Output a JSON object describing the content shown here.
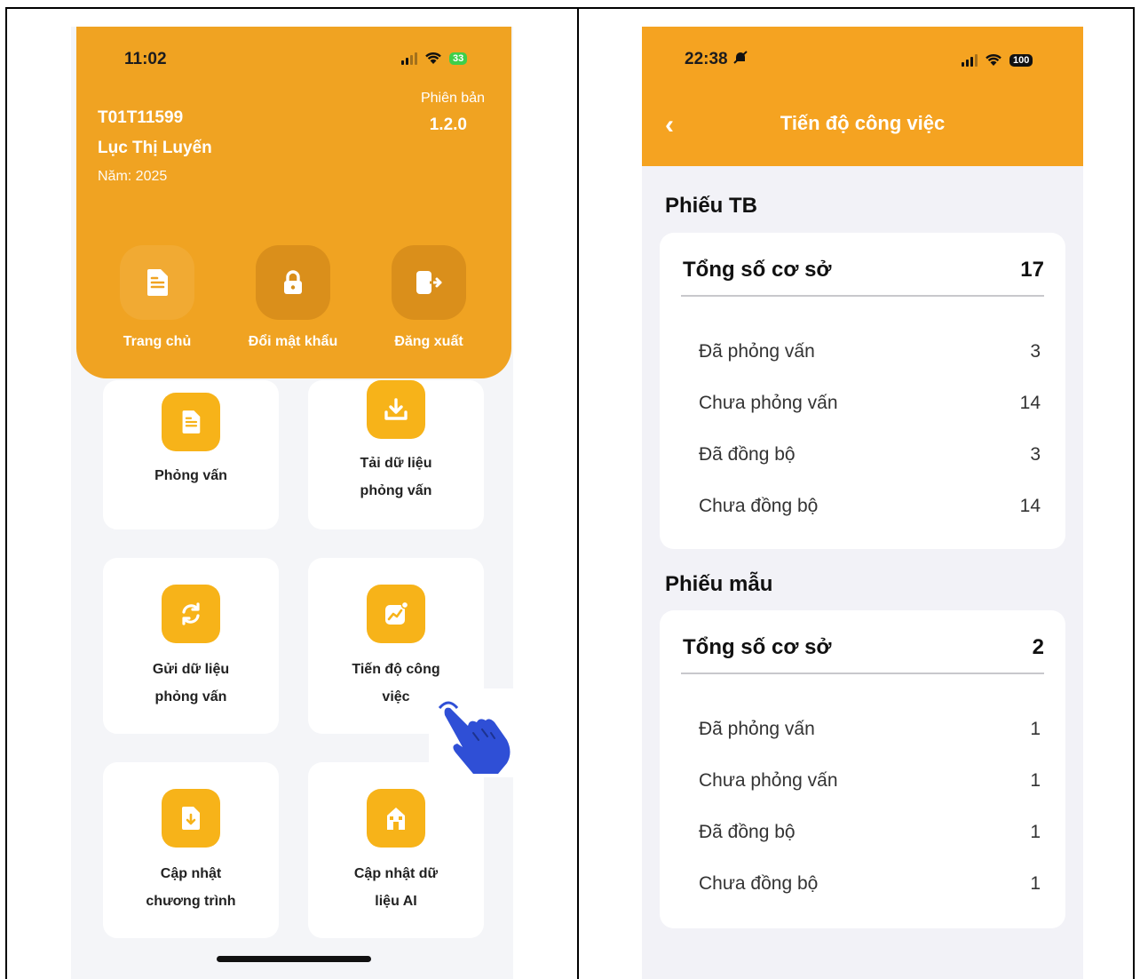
{
  "left": {
    "status": {
      "time": "11:02",
      "battery": "33"
    },
    "user": {
      "code": "T01T11599",
      "name": "Lục Thị Luyến",
      "year": "Năm: 2025"
    },
    "version": {
      "label": "Phiên bản",
      "number": "1.2.0"
    },
    "header_buttons": [
      {
        "label": "Trang chủ",
        "icon": "document-icon"
      },
      {
        "label": "Đổi mật khẩu",
        "icon": "lock-icon"
      },
      {
        "label": "Đăng xuất",
        "icon": "logout-icon"
      }
    ],
    "tiles": [
      {
        "line1": "Phỏng vấn",
        "line2": "",
        "icon": "document-icon"
      },
      {
        "line1": "Tải dữ liệu",
        "line2": "phỏng vấn",
        "icon": "download-icon"
      },
      {
        "line1": "Gửi dữ liệu",
        "line2": "phỏng vấn",
        "icon": "sync-icon"
      },
      {
        "line1": "Tiến độ công",
        "line2": "việc",
        "icon": "chart-icon"
      },
      {
        "line1": "Cập nhật",
        "line2": "chương trình",
        "icon": "update-file-icon"
      },
      {
        "line1": "Cập nhật dữ",
        "line2": "liệu AI",
        "icon": "building-icon"
      }
    ]
  },
  "right": {
    "status": {
      "time": "22:38",
      "battery": "100"
    },
    "title": "Tiến độ công việc",
    "sections": [
      {
        "title": "Phiếu TB",
        "total_label": "Tổng số cơ sở",
        "total_value": "17",
        "rows": [
          {
            "label": "Đã phỏng vấn",
            "value": "3"
          },
          {
            "label": "Chưa phỏng vấn",
            "value": "14"
          },
          {
            "label": "Đã đồng bộ",
            "value": "3"
          },
          {
            "label": "Chưa đồng bộ",
            "value": "14"
          }
        ]
      },
      {
        "title": "Phiếu mẫu",
        "total_label": "Tổng số cơ sở",
        "total_value": "2",
        "rows": [
          {
            "label": "Đã phỏng vấn",
            "value": "1"
          },
          {
            "label": "Chưa phỏng vấn",
            "value": "1"
          },
          {
            "label": "Đã đồng bộ",
            "value": "1"
          },
          {
            "label": "Chưa đồng bộ",
            "value": "1"
          }
        ]
      }
    ]
  },
  "colors": {
    "header": "#f0a322",
    "tile_icon": "#f7b319",
    "hand": "#2f4fd6"
  }
}
